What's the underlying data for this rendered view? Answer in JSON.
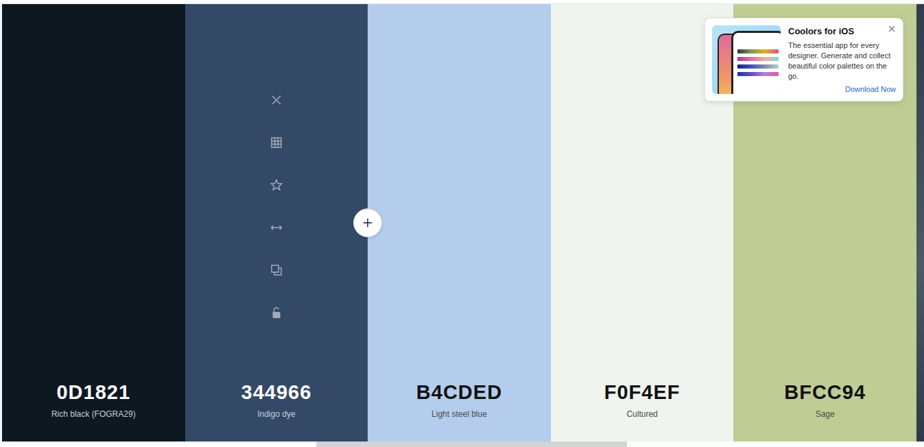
{
  "palette": {
    "columns": [
      {
        "hex": "0D1821",
        "name": "Rich black (FOGRA29)",
        "color": "#0d1821",
        "hovered": false,
        "locked": false
      },
      {
        "hex": "344966",
        "name": "Indigo dye",
        "color": "#344966",
        "hovered": true,
        "locked": false
      },
      {
        "hex": "B4CDED",
        "name": "Light steel blue",
        "color": "#b4cded",
        "hovered": false,
        "locked": false
      },
      {
        "hex": "F0F4EF",
        "name": "Cultured",
        "color": "#f0f4ef",
        "hovered": false,
        "locked": false
      },
      {
        "hex": "BFCC94",
        "name": "Sage",
        "color": "#bfcc94",
        "hovered": false,
        "locked": false
      }
    ]
  },
  "ad": {
    "title": "Coolors for iOS",
    "body": "The essential app for every designer. Generate and collect beautiful color palettes on the go.",
    "link": "Download Now"
  }
}
